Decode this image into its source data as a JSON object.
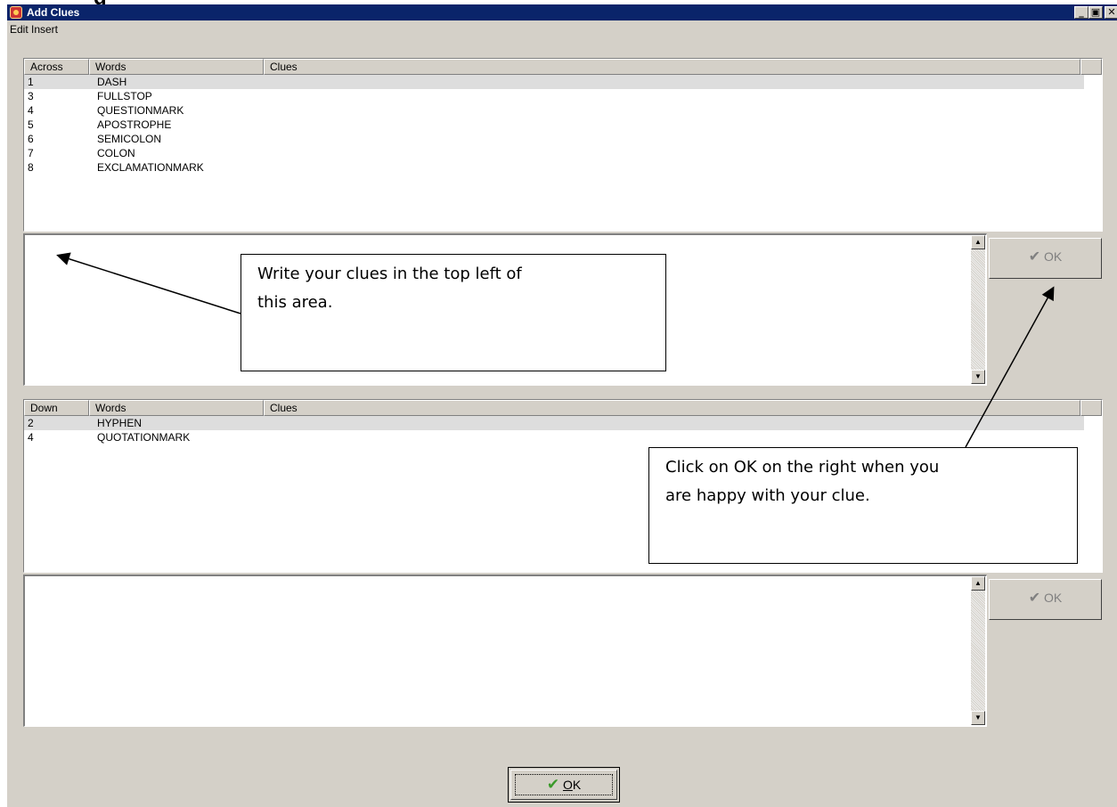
{
  "window": {
    "title": "Add Clues",
    "cutoff_text": "g"
  },
  "titlebar_buttons": {
    "minimize": "_",
    "maximize": "▣",
    "close": "✕"
  },
  "menu": [
    "Edit",
    "Insert"
  ],
  "across": {
    "headers": [
      "Across",
      "Words",
      "Clues"
    ],
    "rows": [
      {
        "num": "1",
        "word": "DASH",
        "clue": ""
      },
      {
        "num": "3",
        "word": "FULLSTOP",
        "clue": ""
      },
      {
        "num": "4",
        "word": "QUESTIONMARK",
        "clue": ""
      },
      {
        "num": "5",
        "word": "APOSTROPHE",
        "clue": ""
      },
      {
        "num": "6",
        "word": "SEMICOLON",
        "clue": ""
      },
      {
        "num": "7",
        "word": "COLON",
        "clue": ""
      },
      {
        "num": "8",
        "word": "EXCLAMATIONMARK",
        "clue": ""
      }
    ],
    "selected_index": 0
  },
  "down": {
    "headers": [
      "Down",
      "Words",
      "Clues"
    ],
    "rows": [
      {
        "num": "2",
        "word": "HYPHEN",
        "clue": ""
      },
      {
        "num": "4",
        "word": "QUOTATIONMARK",
        "clue": ""
      }
    ],
    "selected_index": 0
  },
  "clue_editor_across": {
    "value": ""
  },
  "clue_editor_down": {
    "value": ""
  },
  "ok_side_label": "OK",
  "ok_main_label": "OK",
  "check_icon": "✔",
  "callouts": {
    "top_line1": "Write your clues in the top left of",
    "top_line2": "this area.",
    "right_line1": "Click on OK on the right when you",
    "right_line2": "are happy with your clue."
  }
}
